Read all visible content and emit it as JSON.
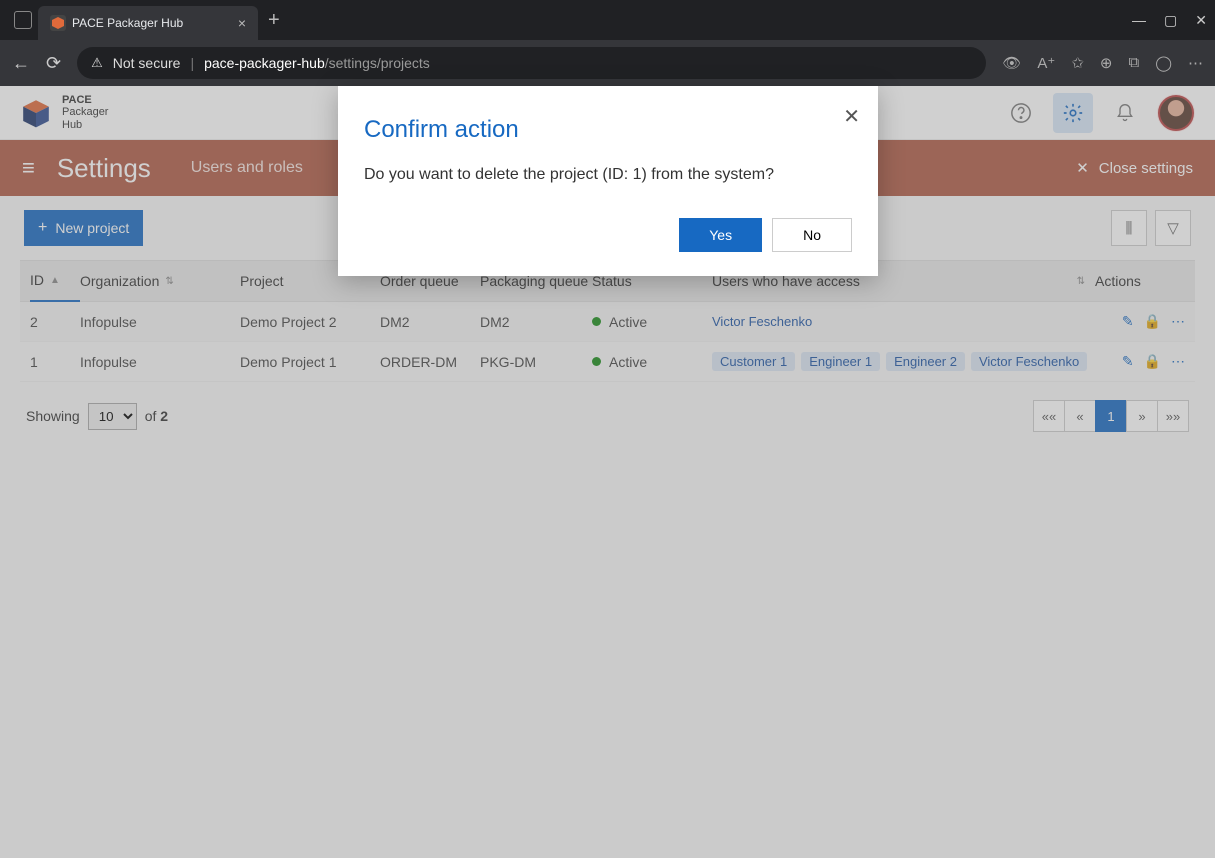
{
  "browser": {
    "tab_title": "PACE Packager Hub",
    "url_prefix": "Not secure",
    "url_host": "pace-packager-hub",
    "url_path": "/settings/projects"
  },
  "app": {
    "logo_line1": "PACE",
    "logo_line2": "Packager",
    "logo_line3": "Hub"
  },
  "settings_bar": {
    "title": "Settings",
    "tab": "Users and roles",
    "close": "Close settings"
  },
  "toolbar": {
    "new_project": "New project"
  },
  "table": {
    "headers": {
      "id": "ID",
      "org": "Organization",
      "proj": "Project",
      "ordq": "Order queue",
      "pkq": "Packaging queue",
      "status": "Status",
      "users": "Users who have access",
      "actions": "Actions"
    },
    "rows": [
      {
        "id": "2",
        "org": "Infopulse",
        "proj": "Demo Project 2",
        "ordq": "DM2",
        "pkq": "DM2",
        "status": "Active",
        "users": [
          {
            "label": "Victor Feschenko",
            "chip": false
          }
        ]
      },
      {
        "id": "1",
        "org": "Infopulse",
        "proj": "Demo Project 1",
        "ordq": "ORDER-DM",
        "pkq": "PKG-DM",
        "status": "Active",
        "users": [
          {
            "label": "Customer 1",
            "chip": true
          },
          {
            "label": "Engineer 1",
            "chip": true
          },
          {
            "label": "Engineer 2",
            "chip": true
          },
          {
            "label": "Victor Feschenko",
            "chip": true
          }
        ]
      }
    ]
  },
  "pager": {
    "showing": "Showing",
    "page_size": "10",
    "of": "of",
    "total": "2",
    "first": "««",
    "prev": "«",
    "page": "1",
    "next": "»",
    "last": "»»"
  },
  "modal": {
    "title": "Confirm action",
    "message": "Do you want to delete the project (ID: 1) from the system?",
    "yes": "Yes",
    "no": "No"
  }
}
